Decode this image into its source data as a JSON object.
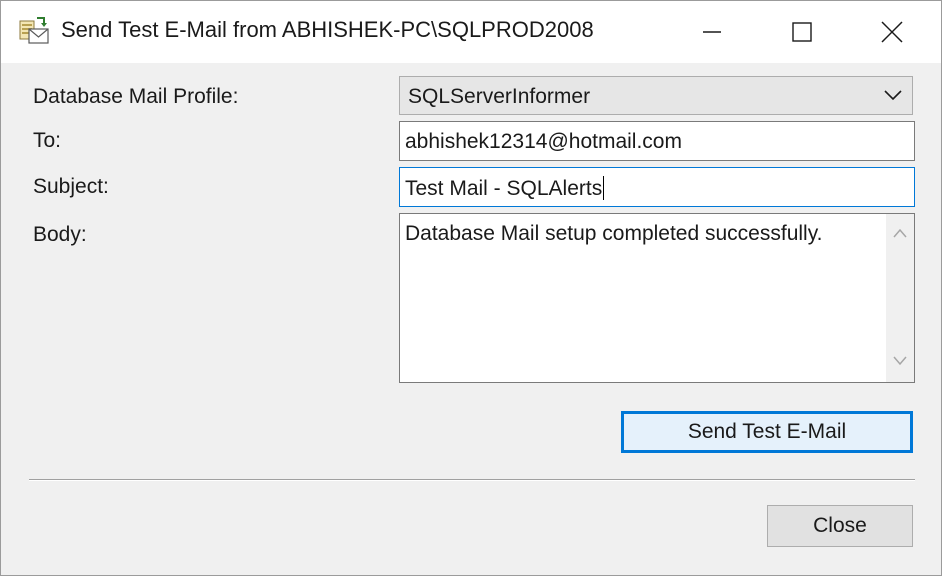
{
  "window": {
    "title": "Send Test E-Mail from ABHISHEK-PC\\SQLPROD2008",
    "app_icon": "database-mail-icon",
    "caption_buttons": {
      "minimize_icon": "minimize-icon",
      "maximize_icon": "maximize-icon",
      "close_icon": "close-icon"
    }
  },
  "form": {
    "profile": {
      "label": "Database Mail Profile:",
      "value": "SQLServerInformer",
      "icon": "chevron-down-icon"
    },
    "to": {
      "label": "To:",
      "value": "abhishek12314@hotmail.com"
    },
    "subject": {
      "label": "Subject:",
      "value": "Test Mail - SQLAlerts"
    },
    "body": {
      "label": "Body:",
      "value": "Database Mail setup completed successfully.",
      "scroll_up_icon": "scroll-up-icon",
      "scroll_down_icon": "scroll-down-icon"
    }
  },
  "buttons": {
    "send_test_label": "Send Test E-Mail",
    "close_label": "Close"
  },
  "colors": {
    "focus_accent": "#0078d7",
    "dialog_background": "#f0f0f0"
  }
}
